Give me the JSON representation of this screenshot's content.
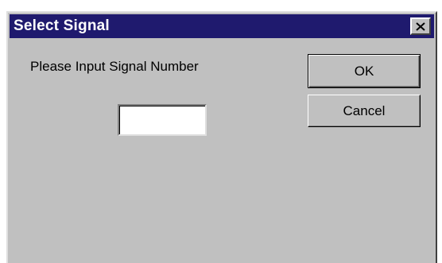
{
  "dialog": {
    "title": "Select Signal",
    "close_icon": "close-x-icon",
    "prompt": "Please Input Signal Number",
    "signal_input": {
      "value": "",
      "placeholder": ""
    },
    "ok_label": "OK",
    "cancel_label": "Cancel"
  },
  "colors": {
    "titlebar": "#1f1a6e",
    "face": "#c0c0c0",
    "title_text": "#ffffff"
  }
}
